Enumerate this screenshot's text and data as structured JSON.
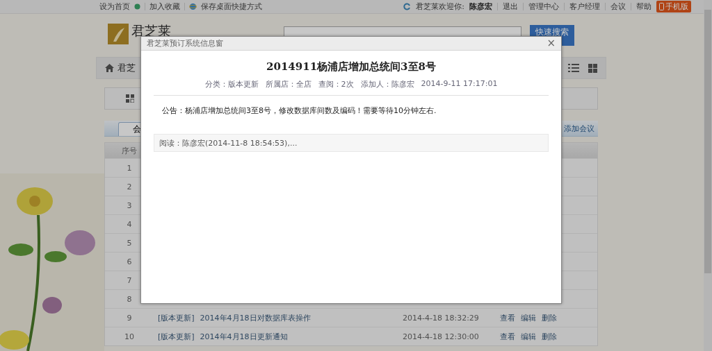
{
  "top_bar": {
    "left_links": [
      {
        "label": "设为首页",
        "kind": "dot"
      },
      {
        "label": "加入收藏",
        "kind": "plain"
      },
      {
        "label": "保存桌面快捷方式",
        "kind": "globe"
      }
    ],
    "welcome": "君芝莱欢迎你:",
    "user": "陈彦宏",
    "right_links": [
      "退出",
      "管理中心",
      "客户经理",
      "会议",
      "帮助"
    ],
    "mobile_button": "手机版"
  },
  "header": {
    "logo": "君芝莱",
    "search_button": "快速搜索"
  },
  "breadcrumb": "君芝",
  "tabs": [
    {
      "label": "会",
      "selected": true
    }
  ],
  "add_button": "添加会议",
  "table": {
    "columns": [
      "序号"
    ],
    "rows": [
      {
        "no": "1"
      },
      {
        "no": "2"
      },
      {
        "no": "3"
      },
      {
        "no": "4"
      },
      {
        "no": "5"
      },
      {
        "no": "6"
      },
      {
        "no": "7"
      },
      {
        "no": "8"
      },
      {
        "no": "9",
        "category": "[版本更新]",
        "title": "2014年4月18日对数据库表操作",
        "date": "2014-4-18 18:32:29",
        "actions": [
          "查看",
          "编辑",
          "删除"
        ]
      },
      {
        "no": "10",
        "category": "[版本更新]",
        "title": "2014年4月18日更新通知",
        "date": "2014-4-18 12:30:00",
        "actions": [
          "查看",
          "编辑",
          "删除"
        ]
      }
    ]
  },
  "dialog": {
    "title": "君芝莱预订系统信息窗",
    "close": "×",
    "heading": "2014911杨浦店增加总统间3至8号",
    "meta": [
      "分类：版本更新",
      "所属店：全店",
      "查阅：2次",
      "添加人：陈彦宏",
      "2014-9-11 17:17:01"
    ],
    "body": "公告：杨浦店增加总统间3至8号，修改数据库间数及编码！需要等待10分钟左右.",
    "readers": "阅读：陈彦宏(2014-11-8 18:54:53),..."
  }
}
